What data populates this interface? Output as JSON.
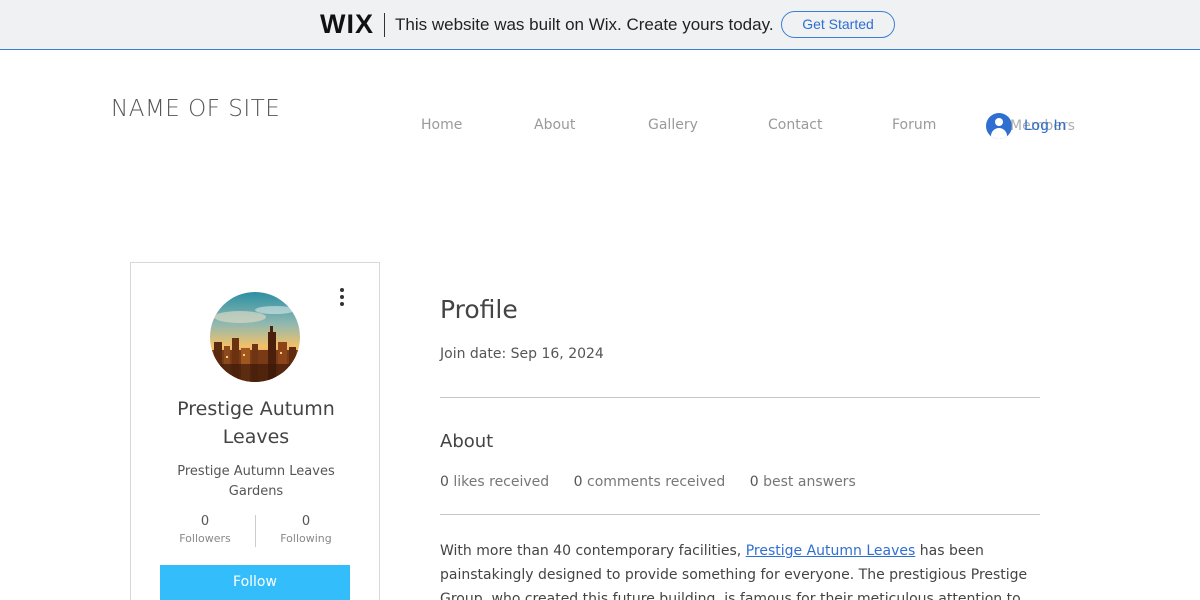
{
  "banner": {
    "logo": "WIX",
    "message": "This website was built on Wix. Create yours today.",
    "cta_label": "Get Started"
  },
  "site": {
    "name": "NAME OF SITE"
  },
  "nav": {
    "items": [
      {
        "label": "Home"
      },
      {
        "label": "About"
      },
      {
        "label": "Gallery"
      },
      {
        "label": "Contact"
      },
      {
        "label": "Forum"
      }
    ],
    "login_label": "Log In",
    "members_label": "Members"
  },
  "card": {
    "name": "Prestige Autumn Leaves",
    "subtitle": "Prestige Autumn Leaves Gardens",
    "followers_count": "0",
    "followers_label": "Followers",
    "following_count": "0",
    "following_label": "Following",
    "follow_label": "Follow",
    "menu_icon": "more-vertical-icon"
  },
  "profile": {
    "title": "Profile",
    "join_date": "Join date: Sep 16, 2024",
    "about_title": "About",
    "likes_count": "0",
    "likes_label": "likes received",
    "comments_count": "0",
    "comments_label": "comments received",
    "answers_count": "0",
    "answers_label": "best answers",
    "bio_before": "With more than 40 contemporary facilities, ",
    "bio_link": "Prestige Autumn Leaves",
    "bio_after": " has been painstakingly designed to provide something for everyone. The prestigious Prestige Group, who created this future building, is famous for their meticulous attention to"
  },
  "colors": {
    "accent": "#2f6fd1",
    "follow_button": "#33bdfa",
    "banner_bg": "#eff1f3"
  }
}
